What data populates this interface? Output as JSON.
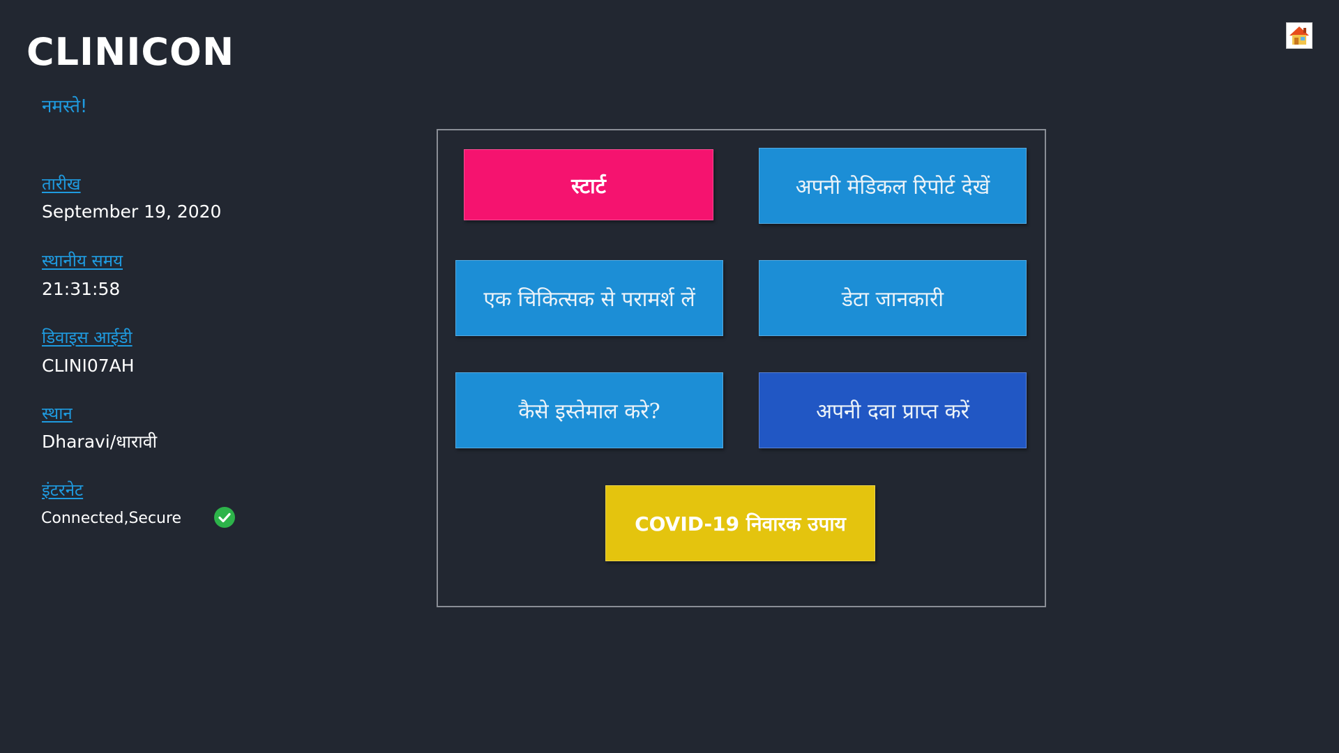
{
  "app": {
    "title": "CLINICON",
    "greeting": "नमस्ते!"
  },
  "info": {
    "date_label": "तारीख",
    "date_value": "September 19, 2020",
    "time_label": "स्थानीय समय",
    "time_value": "21:31:58",
    "device_label": "डिवाइस आईडी",
    "device_value": "CLINI07AH",
    "location_label": "स्थान",
    "location_value": "Dharavi/धारावी",
    "internet_label": "इंटरनेट",
    "internet_value": "Connected,Secure",
    "internet_status_icon": "check-circle-icon"
  },
  "header": {
    "home_icon": "home-icon"
  },
  "menu": {
    "start_label": "स्टार्ट",
    "report_label": "अपनी मेडिकल रिपोर्ट देखें",
    "consult_label": "एक चिकित्सक से परामर्श लें",
    "data_label": "डेटा जानकारी",
    "howto_label": "कैसे इस्तेमाल करे?",
    "medicine_label": "अपनी दवा प्राप्त करें",
    "covid_label": "COVID-19 निवारक उपाय"
  },
  "colors": {
    "background": "#222731",
    "accent_text": "#1f9be0",
    "start_button": "#f5136f",
    "primary_button": "#1c8ed6",
    "medicine_button": "#2157c4",
    "covid_button": "#e4c40e",
    "status_ok": "#2db34a"
  }
}
